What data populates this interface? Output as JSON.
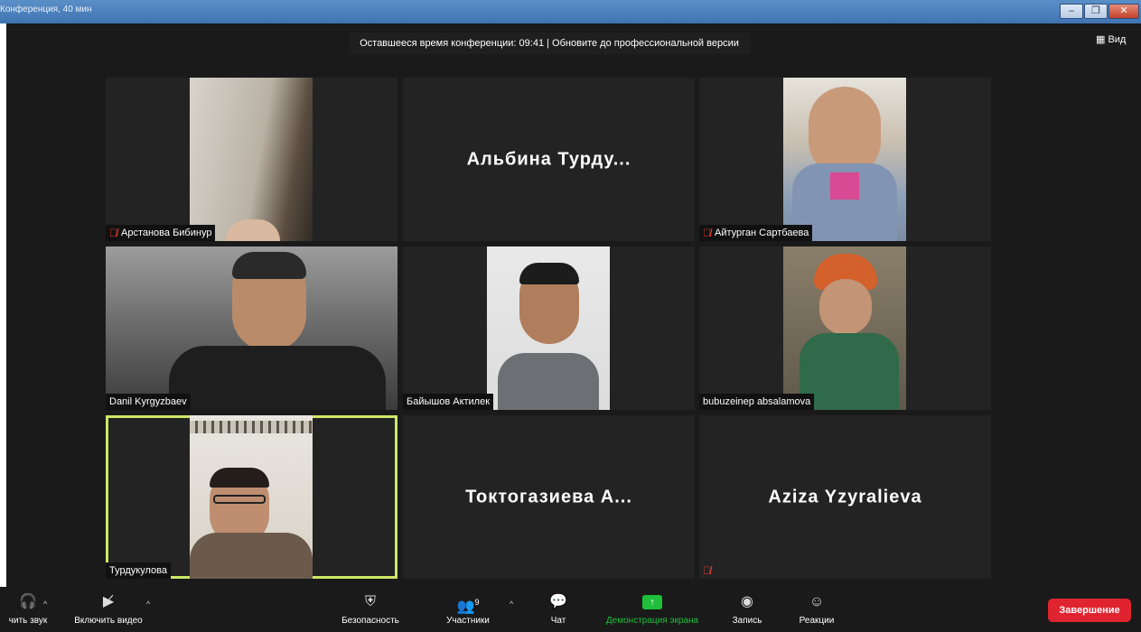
{
  "window": {
    "title": "Конференция, 40 мин",
    "minimize": "–",
    "maximize": "❐",
    "close": "✕"
  },
  "banner": {
    "text": "Оставшееся время конференции: 09:41 | Обновите до профессиональной версии"
  },
  "view": {
    "label": "▦ Вид"
  },
  "participants": [
    {
      "name": "Арстанова Бибинур",
      "muted": true,
      "video": true
    },
    {
      "name": "",
      "display_name": "Альбина  Турду...",
      "muted": false,
      "video": false
    },
    {
      "name": "Айтурган Сартбаева",
      "muted": true,
      "video": true
    },
    {
      "name": "Danil Kyrgyzbaev",
      "muted": false,
      "video": true
    },
    {
      "name": "Байышов Актилек",
      "muted": false,
      "video": true
    },
    {
      "name": "bubuzeinep absalamova",
      "muted": false,
      "video": true
    },
    {
      "name": "Турдукулова",
      "muted": false,
      "video": true,
      "active": true
    },
    {
      "name": "",
      "display_name": "Токтогазиева  А...",
      "muted": false,
      "video": false
    },
    {
      "name": "",
      "display_name": "Aziza Yzyralieva",
      "muted": true,
      "video": false
    }
  ],
  "toolbar": {
    "audio_label": "чить звук",
    "video_label": "Включить видео",
    "security_label": "Безопасность",
    "participants_label": "Участники",
    "participants_count": "9",
    "chat_label": "Чат",
    "share_label": "Демонстрация экрана",
    "record_label": "Запись",
    "reactions_label": "Реакции",
    "end_label": "Завершение"
  },
  "icons": {
    "mic_muted": "mic-muted-icon",
    "video_off": "video-off-icon",
    "security": "shield-icon",
    "participants": "people-icon",
    "chat": "chat-icon",
    "share": "share-screen-icon",
    "record": "record-icon",
    "reactions": "smiley-icon"
  },
  "colors": {
    "share_label": "#1fbf3a",
    "end_button": "#e0242f",
    "active_speaker": "#cde866",
    "muted_mic": "#e23b2e"
  }
}
